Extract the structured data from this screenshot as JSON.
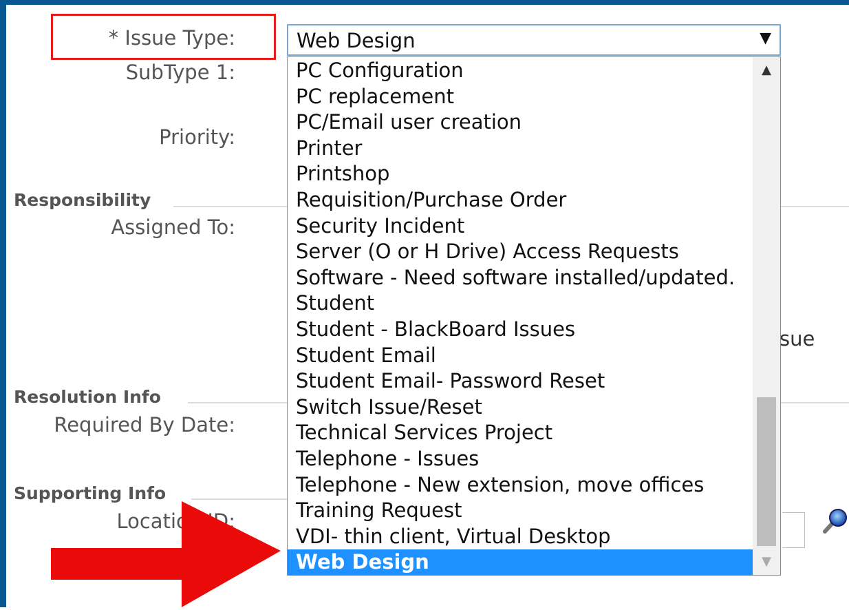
{
  "form": {
    "issue_type_label": "* Issue Type:",
    "subtype_label": "SubType 1:",
    "priority_label": "Priority:",
    "assigned_to_label": "Assigned To:",
    "required_by_label": "Required By Date:",
    "location_label": "Location ID:",
    "partial_text": "sue"
  },
  "sections": {
    "responsibility": "Responsibility",
    "resolution": "Resolution Info",
    "supporting": "Supporting Info"
  },
  "select": {
    "value": "Web Design",
    "arrow": "▼"
  },
  "dropdown_options": [
    "PC Configuration",
    "PC replacement",
    "PC/Email user creation",
    "Printer",
    "Printshop",
    "Requisition/Purchase Order",
    "Security Incident",
    "Server (O or H Drive) Access Requests",
    "Software - Need software installed/updated.",
    "Student",
    "Student - BlackBoard Issues",
    "Student Email",
    "Student Email- Password Reset",
    "Switch Issue/Reset",
    "Technical Services Project",
    "Telephone - Issues",
    "Telephone - New extension, move offices",
    "Training Request",
    "VDI- thin client, Virtual Desktop",
    "Web Design"
  ],
  "icons": {
    "scroll_up": "▲",
    "scroll_down": "▼",
    "lookup": "magnifier-icon",
    "pointer": "red-arrow-icon"
  },
  "colors": {
    "frame": "#08578f",
    "selected": "#1e90ff",
    "highlight": "#e31b1b"
  }
}
